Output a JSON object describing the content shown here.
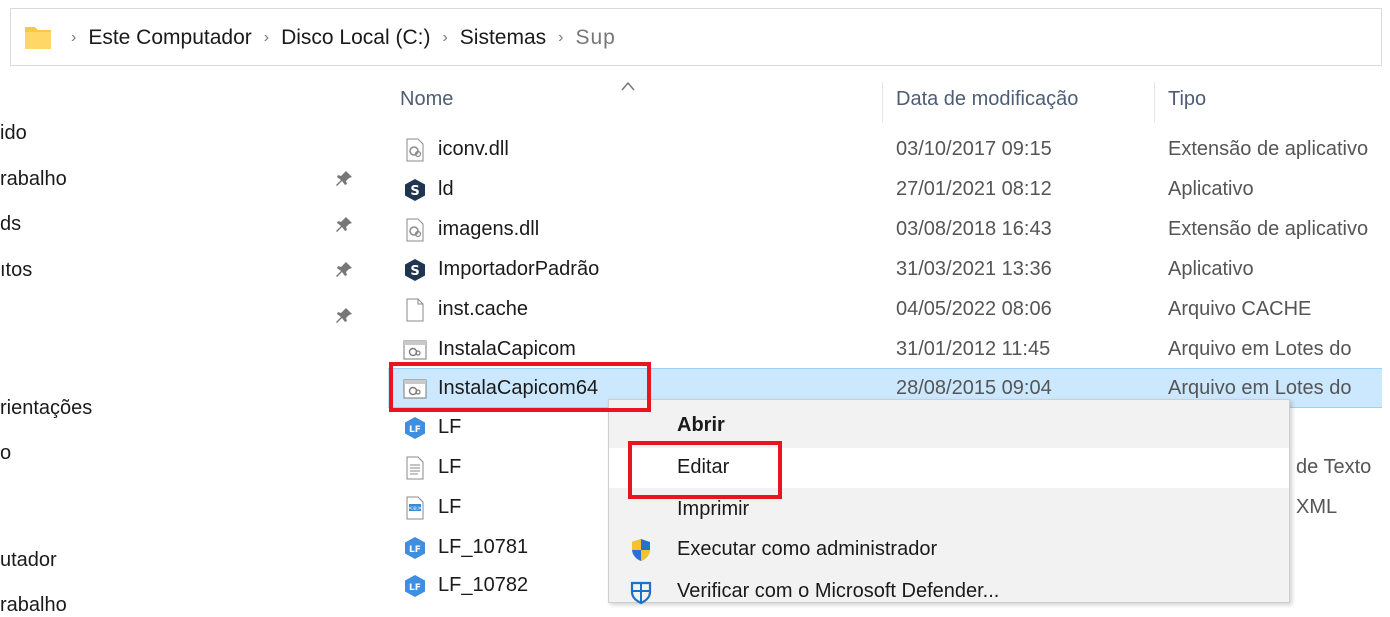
{
  "breadcrumb": {
    "items": [
      "Este Computador",
      "Disco Local (C:)",
      "Sistemas",
      "Sup"
    ]
  },
  "nav": {
    "items": [
      {
        "label": "ido",
        "pinned": false
      },
      {
        "label": "rabalho",
        "pinned": true
      },
      {
        "label": "ds",
        "pinned": true
      },
      {
        "label": "ıtos",
        "pinned": true
      },
      {
        "label": "",
        "pinned": true
      },
      {
        "label": "rientações",
        "pinned": false
      },
      {
        "label": "o",
        "pinned": false
      },
      {
        "label": "utador",
        "pinned": false
      },
      {
        "label": "rabalho",
        "pinned": false
      }
    ]
  },
  "columns": {
    "name": "Nome",
    "date": "Data de modificação",
    "type": "Tipo"
  },
  "files": [
    {
      "name": "iconv.dll",
      "date": "03/10/2017 09:15",
      "type": "Extensão de aplicativo",
      "icon": "dll-icon"
    },
    {
      "name": "ld",
      "date": "27/01/2021 08:12",
      "type": "Aplicativo",
      "icon": "app-s-icon"
    },
    {
      "name": "imagens.dll",
      "date": "03/08/2018 16:43",
      "type": "Extensão de aplicativo",
      "icon": "dll-icon"
    },
    {
      "name": "ImportadorPadrão",
      "date": "31/03/2021 13:36",
      "type": "Aplicativo",
      "icon": "app-s-icon"
    },
    {
      "name": "inst.cache",
      "date": "04/05/2022 08:06",
      "type": "Arquivo CACHE",
      "icon": "blank-file-icon"
    },
    {
      "name": "InstalaCapicom",
      "date": "31/01/2012 11:45",
      "type": "Arquivo em Lotes do",
      "icon": "batch-file-icon"
    },
    {
      "name": "InstalaCapicom64",
      "date": "28/08/2015 09:04",
      "type": "Arquivo em Lotes do",
      "icon": "batch-file-icon",
      "selected": true
    },
    {
      "name": "LF",
      "date": "",
      "type": "",
      "icon": "lf-app-icon"
    },
    {
      "name": "LF",
      "date": "",
      "type": "de Texto",
      "icon": "text-file-icon"
    },
    {
      "name": "LF",
      "date": "",
      "type": "XML",
      "icon": "xml-file-icon"
    },
    {
      "name": "LF_10781",
      "date": "",
      "type": "",
      "icon": "lf-app-icon"
    },
    {
      "name": "LF_10782",
      "date": "",
      "type": "",
      "icon": "lf-app-icon"
    }
  ],
  "context_menu": {
    "items": [
      {
        "label": "Abrir",
        "bold": true
      },
      {
        "label": "Editar",
        "hover": true
      },
      {
        "label": "Imprimir"
      },
      {
        "label": "Executar como administrador",
        "icon": "uac-shield-icon"
      },
      {
        "label": "Verificar com o Microsoft Defender...",
        "icon": "defender-icon"
      }
    ]
  },
  "colors": {
    "selection": "#cce8ff",
    "highlight_box": "#e8141f",
    "header_text": "#4d5d75"
  }
}
